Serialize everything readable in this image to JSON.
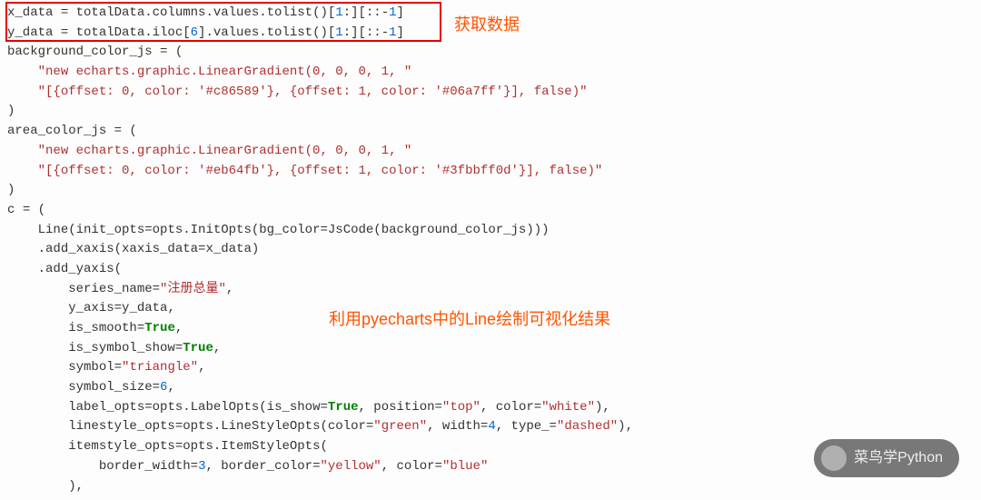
{
  "annotations": {
    "get_data": "获取数据",
    "line_desc": "利用pyecharts中的Line绘制可视化结果"
  },
  "watermark": {
    "text": "菜鸟学Python"
  },
  "code": {
    "lines": [
      {
        "indent": 0,
        "tokens": [
          {
            "t": "x_data ",
            "c": "def"
          },
          {
            "t": "=",
            "c": "punc"
          },
          {
            "t": " totalData.columns.values.tolist()[",
            "c": "def"
          },
          {
            "t": "1",
            "c": "num"
          },
          {
            "t": ":][::-",
            "c": "def"
          },
          {
            "t": "1",
            "c": "num"
          },
          {
            "t": "]",
            "c": "def"
          }
        ]
      },
      {
        "indent": 0,
        "tokens": [
          {
            "t": "y_data ",
            "c": "def"
          },
          {
            "t": "=",
            "c": "punc"
          },
          {
            "t": " totalData.iloc[",
            "c": "def"
          },
          {
            "t": "6",
            "c": "num"
          },
          {
            "t": "].values.tolist()[",
            "c": "def"
          },
          {
            "t": "1",
            "c": "num"
          },
          {
            "t": ":][::-",
            "c": "def"
          },
          {
            "t": "1",
            "c": "num"
          },
          {
            "t": "]",
            "c": "def"
          }
        ]
      },
      {
        "indent": 0,
        "tokens": [
          {
            "t": "background_color_js ",
            "c": "def"
          },
          {
            "t": "=",
            "c": "punc"
          },
          {
            "t": " (",
            "c": "def"
          }
        ]
      },
      {
        "indent": 1,
        "tokens": [
          {
            "t": "\"new echarts.graphic.LinearGradient(0, 0, 0, 1, \"",
            "c": "str"
          }
        ]
      },
      {
        "indent": 1,
        "tokens": [
          {
            "t": "\"[{offset: 0, color: '#c86589'}, {offset: 1, color: '#06a7ff'}], false)\"",
            "c": "str"
          }
        ]
      },
      {
        "indent": 0,
        "tokens": [
          {
            "t": ")",
            "c": "def"
          }
        ]
      },
      {
        "indent": 0,
        "tokens": [
          {
            "t": "area_color_js ",
            "c": "def"
          },
          {
            "t": "=",
            "c": "punc"
          },
          {
            "t": " (",
            "c": "def"
          }
        ]
      },
      {
        "indent": 1,
        "tokens": [
          {
            "t": "\"new echarts.graphic.LinearGradient(0, 0, 0, 1, \"",
            "c": "str"
          }
        ]
      },
      {
        "indent": 1,
        "tokens": [
          {
            "t": "\"[{offset: 0, color: '#eb64fb'}, {offset: 1, color: '#3fbbff0d'}], false)\"",
            "c": "str"
          }
        ]
      },
      {
        "indent": 0,
        "tokens": [
          {
            "t": ")",
            "c": "def"
          }
        ]
      },
      {
        "indent": 0,
        "tokens": [
          {
            "t": "",
            "c": "def"
          }
        ]
      },
      {
        "indent": 0,
        "tokens": [
          {
            "t": "c ",
            "c": "def"
          },
          {
            "t": "=",
            "c": "punc"
          },
          {
            "t": " (",
            "c": "def"
          }
        ]
      },
      {
        "indent": 1,
        "tokens": [
          {
            "t": "Line(init_opts",
            "c": "def"
          },
          {
            "t": "=",
            "c": "punc"
          },
          {
            "t": "opts.InitOpts(bg_color",
            "c": "def"
          },
          {
            "t": "=",
            "c": "punc"
          },
          {
            "t": "JsCode(background_color_js)))",
            "c": "def"
          }
        ]
      },
      {
        "indent": 1,
        "tokens": [
          {
            "t": ".add_xaxis(xaxis_data",
            "c": "def"
          },
          {
            "t": "=",
            "c": "punc"
          },
          {
            "t": "x_data)",
            "c": "def"
          }
        ]
      },
      {
        "indent": 1,
        "tokens": [
          {
            "t": ".add_yaxis(",
            "c": "def"
          }
        ]
      },
      {
        "indent": 2,
        "tokens": [
          {
            "t": "series_name",
            "c": "def"
          },
          {
            "t": "=",
            "c": "punc"
          },
          {
            "t": "\"注册总量\"",
            "c": "str"
          },
          {
            "t": ",",
            "c": "def"
          }
        ]
      },
      {
        "indent": 2,
        "tokens": [
          {
            "t": "y_axis",
            "c": "def"
          },
          {
            "t": "=",
            "c": "punc"
          },
          {
            "t": "y_data,",
            "c": "def"
          }
        ]
      },
      {
        "indent": 2,
        "tokens": [
          {
            "t": "is_smooth",
            "c": "def"
          },
          {
            "t": "=",
            "c": "punc"
          },
          {
            "t": "True",
            "c": "bool"
          },
          {
            "t": ",",
            "c": "def"
          }
        ]
      },
      {
        "indent": 2,
        "tokens": [
          {
            "t": "is_symbol_show",
            "c": "def"
          },
          {
            "t": "=",
            "c": "punc"
          },
          {
            "t": "True",
            "c": "bool"
          },
          {
            "t": ",",
            "c": "def"
          }
        ]
      },
      {
        "indent": 2,
        "tokens": [
          {
            "t": "symbol",
            "c": "def"
          },
          {
            "t": "=",
            "c": "punc"
          },
          {
            "t": "\"triangle\"",
            "c": "str"
          },
          {
            "t": ",",
            "c": "def"
          }
        ]
      },
      {
        "indent": 2,
        "tokens": [
          {
            "t": "symbol_size",
            "c": "def"
          },
          {
            "t": "=",
            "c": "punc"
          },
          {
            "t": "6",
            "c": "num"
          },
          {
            "t": ",",
            "c": "def"
          }
        ]
      },
      {
        "indent": 2,
        "tokens": [
          {
            "t": "label_opts",
            "c": "def"
          },
          {
            "t": "=",
            "c": "punc"
          },
          {
            "t": "opts.LabelOpts(is_show",
            "c": "def"
          },
          {
            "t": "=",
            "c": "punc"
          },
          {
            "t": "True",
            "c": "bool"
          },
          {
            "t": ", position",
            "c": "def"
          },
          {
            "t": "=",
            "c": "punc"
          },
          {
            "t": "\"top\"",
            "c": "str"
          },
          {
            "t": ", color",
            "c": "def"
          },
          {
            "t": "=",
            "c": "punc"
          },
          {
            "t": "\"white\"",
            "c": "str"
          },
          {
            "t": "),",
            "c": "def"
          }
        ]
      },
      {
        "indent": 2,
        "tokens": [
          {
            "t": "linestyle_opts",
            "c": "def"
          },
          {
            "t": "=",
            "c": "punc"
          },
          {
            "t": "opts.LineStyleOpts(color",
            "c": "def"
          },
          {
            "t": "=",
            "c": "punc"
          },
          {
            "t": "\"green\"",
            "c": "str"
          },
          {
            "t": ", width",
            "c": "def"
          },
          {
            "t": "=",
            "c": "punc"
          },
          {
            "t": "4",
            "c": "num"
          },
          {
            "t": ", type_",
            "c": "def"
          },
          {
            "t": "=",
            "c": "punc"
          },
          {
            "t": "\"dashed\"",
            "c": "str"
          },
          {
            "t": "),",
            "c": "def"
          }
        ]
      },
      {
        "indent": 2,
        "tokens": [
          {
            "t": "itemstyle_opts",
            "c": "def"
          },
          {
            "t": "=",
            "c": "punc"
          },
          {
            "t": "opts.ItemStyleOpts(",
            "c": "def"
          }
        ]
      },
      {
        "indent": 3,
        "tokens": [
          {
            "t": "border_width",
            "c": "def"
          },
          {
            "t": "=",
            "c": "punc"
          },
          {
            "t": "3",
            "c": "num"
          },
          {
            "t": ", border_color",
            "c": "def"
          },
          {
            "t": "=",
            "c": "punc"
          },
          {
            "t": "\"yellow\"",
            "c": "str"
          },
          {
            "t": ", color",
            "c": "def"
          },
          {
            "t": "=",
            "c": "punc"
          },
          {
            "t": "\"blue\"",
            "c": "str"
          }
        ]
      },
      {
        "indent": 2,
        "tokens": [
          {
            "t": "),",
            "c": "def"
          }
        ]
      }
    ]
  }
}
